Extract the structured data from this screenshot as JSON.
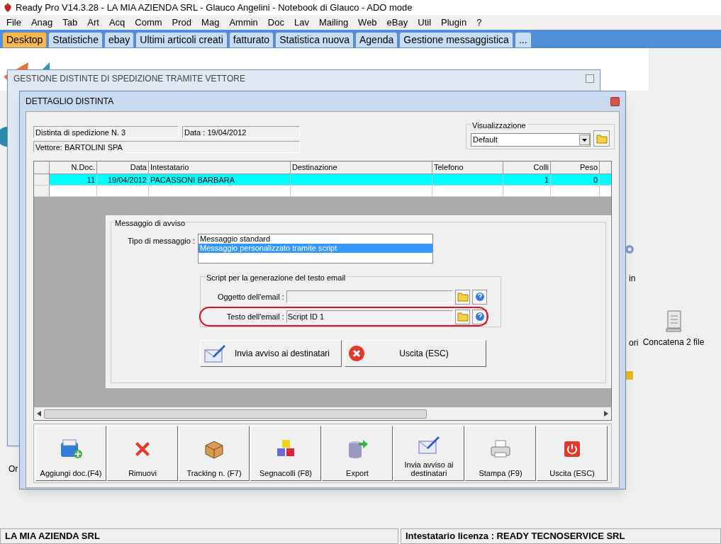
{
  "window": {
    "title": "Ready Pro V14.3.28 - LA MIA AZIENDA SRL - Glauco Angelini - Notebook di Glauco - ADO mode"
  },
  "menu": [
    "File",
    "Anag",
    "Tab",
    "Art",
    "Acq",
    "Comm",
    "Prod",
    "Mag",
    "Ammin",
    "Doc",
    "Lav",
    "Mailing",
    "Web",
    "eBay",
    "Util",
    "Plugin",
    "?"
  ],
  "tabs": [
    {
      "label": "Desktop",
      "selected": true
    },
    {
      "label": "Statistiche",
      "selected": false
    },
    {
      "label": "ebay",
      "selected": false
    },
    {
      "label": "Ultimi articoli creati",
      "selected": false
    },
    {
      "label": "fatturato",
      "selected": false
    },
    {
      "label": "Statistica nuova",
      "selected": false
    },
    {
      "label": "Agenda",
      "selected": false
    },
    {
      "label": "Gestione messaggistica",
      "selected": false
    },
    {
      "label": "...",
      "selected": false
    }
  ],
  "desktop": {
    "fragments": [
      "in",
      "ori",
      "Or"
    ],
    "shortcut": "Concatena 2 file"
  },
  "back_window": {
    "title": "GESTIONE DISTINTE DI SPEDIZIONE TRAMITE VETTORE"
  },
  "detail_window": {
    "title": "DETTAGLIO DISTINTA",
    "distinta": "Distinta di spedizione N. 3",
    "data": "Data : 19/04/2012",
    "vettore": "Vettore: BARTOLINI SPA",
    "view": {
      "label": "Visualizzazione",
      "value": "Default"
    },
    "table": {
      "columns": [
        "N.Doc.",
        "Data",
        "Intestatario",
        "Destinazione",
        "Telefono",
        "Colli",
        "Peso"
      ],
      "rows": [
        {
          "cells": [
            "11",
            "19/04/2012",
            "PACASSONI BARBARA",
            "",
            "",
            "1",
            "0"
          ],
          "selected": true
        },
        {
          "cells": [
            "",
            "",
            "",
            "",
            "",
            "",
            ""
          ],
          "selected": false
        }
      ]
    },
    "message": {
      "group": "Messaggio di avviso",
      "type_label": "Tipo di messaggio :",
      "types": [
        {
          "label": "Messaggio standard",
          "selected": false
        },
        {
          "label": "Messaggio personalizzato tramite script",
          "selected": true
        }
      ],
      "script_group": "Script per la generazione del testo email",
      "fields": [
        {
          "label": "Oggetto dell'email :",
          "highlighted": false
        },
        {
          "label": "Testo dell'email :",
          "value": "Script ID 1",
          "highlighted": true
        }
      ],
      "buttons": [
        {
          "kind": "send",
          "label": "Invia avviso ai destinatari"
        },
        {
          "kind": "exit",
          "label": "Uscita (ESC)"
        }
      ]
    },
    "toolbar": [
      {
        "kind": "add",
        "label": "Aggiungi doc.(F4)"
      },
      {
        "kind": "remove",
        "label": "Rimuovi"
      },
      {
        "kind": "tracking",
        "label": "Tracking n. (F7)"
      },
      {
        "kind": "labels",
        "label": "Segnacolli (F8)"
      },
      {
        "kind": "export",
        "label": "Export"
      },
      {
        "kind": "send",
        "label": "Invia avviso ai destinatari"
      },
      {
        "kind": "print",
        "label": "Stampa (F9)"
      },
      {
        "kind": "exit",
        "label": "Uscita (ESC)"
      }
    ]
  },
  "status_bar": [
    "LA MIA AZIENDA SRL",
    "Intestatario licenza : READY TECNOSERVICE SRL"
  ]
}
